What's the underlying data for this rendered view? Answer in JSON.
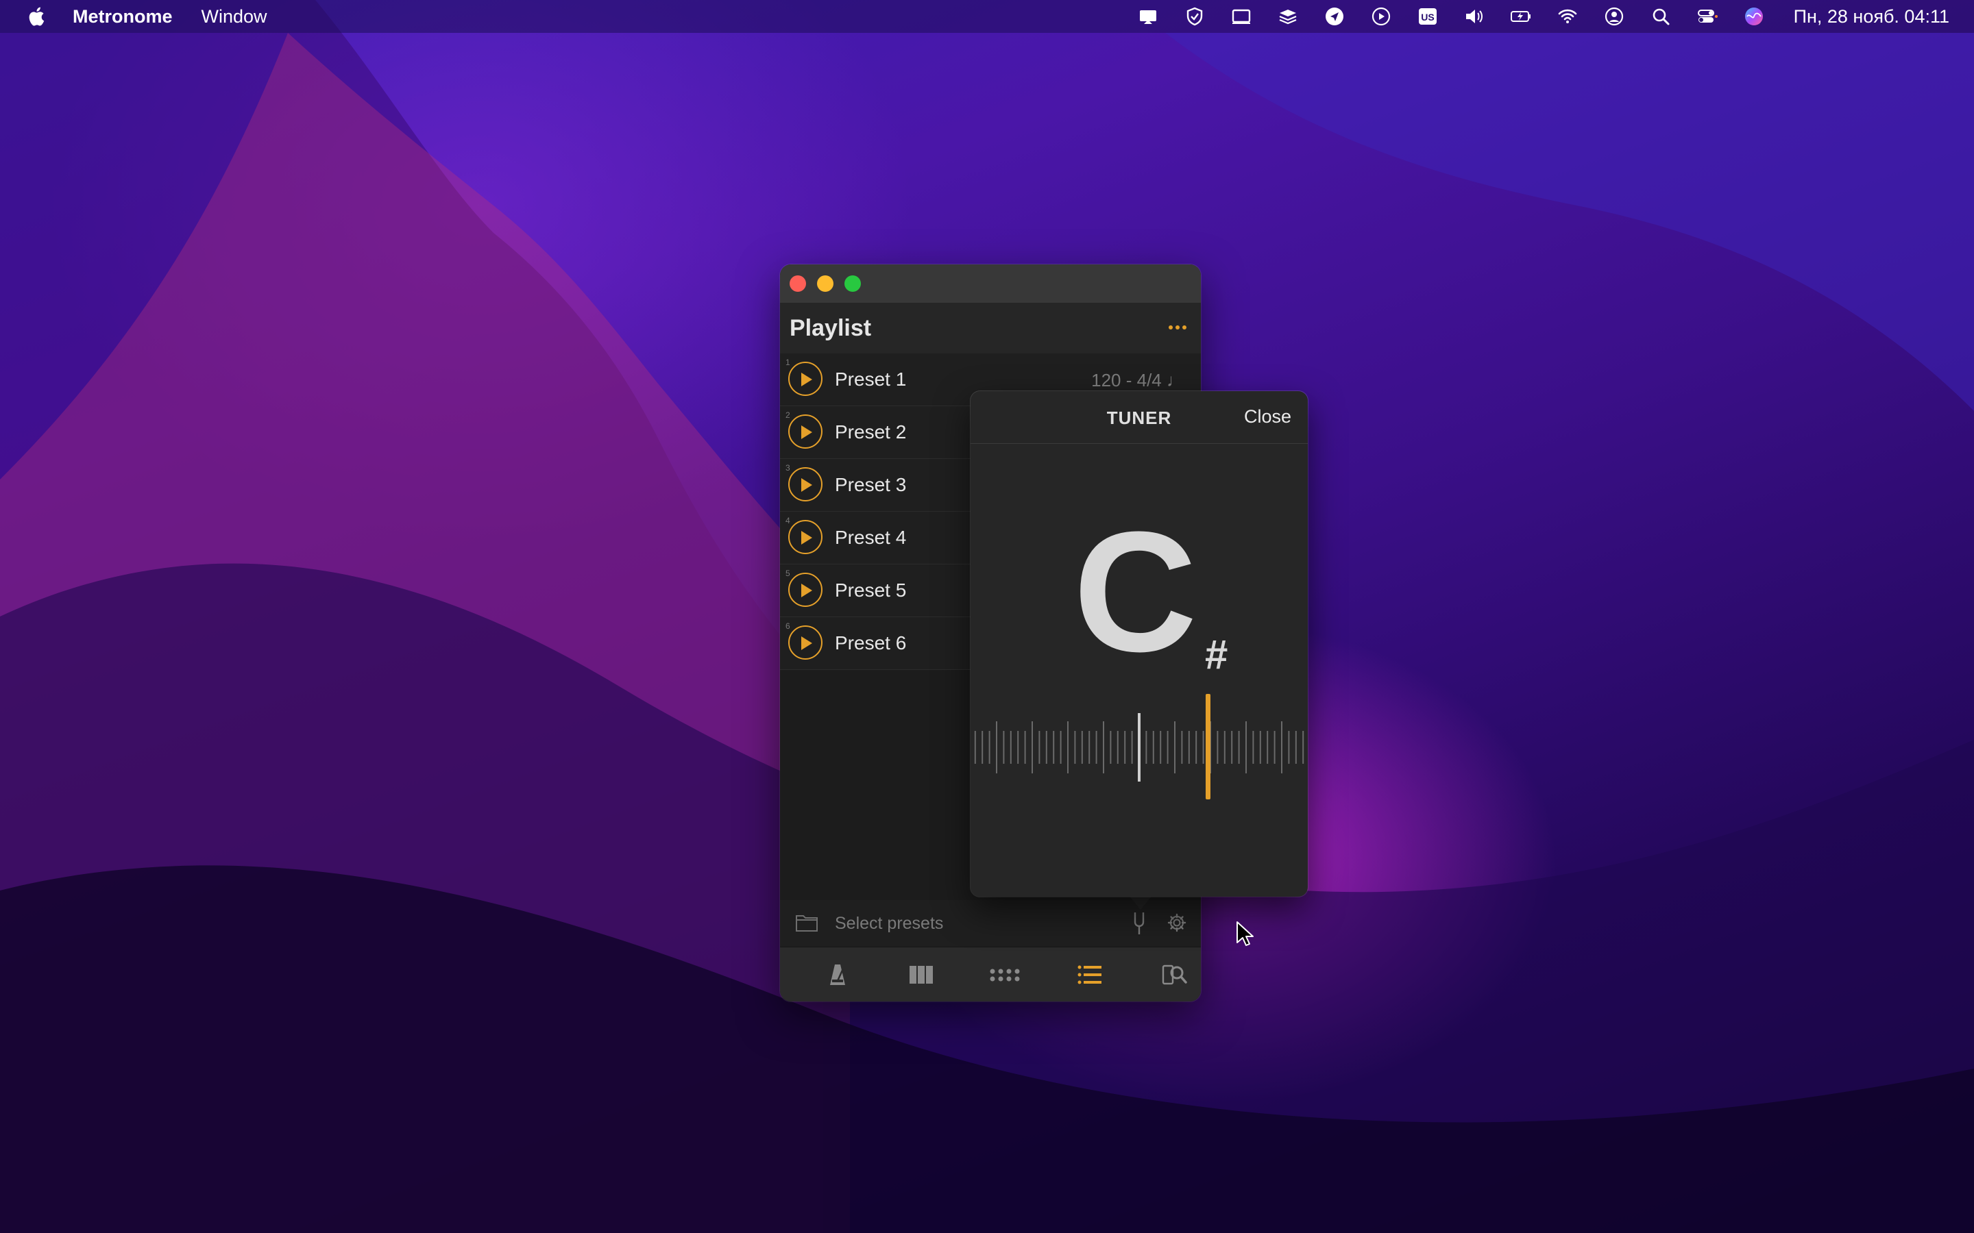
{
  "menubar": {
    "app_name": "Metronome",
    "menu_window": "Window",
    "clock": "Пн, 28 нояб. 04:11",
    "status_icons": [
      "screen-share-icon",
      "shield-icon",
      "display-icon",
      "stack-icon",
      "location-arrow-icon",
      "play-circle-icon",
      "input-source-us-icon",
      "volume-icon",
      "battery-charging-icon",
      "wifi-icon",
      "user-circle-icon",
      "spotlight-search-icon",
      "control-center-icon",
      "siri-icon"
    ],
    "input_source_label": "US"
  },
  "window": {
    "header_title": "Playlist",
    "presets": [
      {
        "index": "1",
        "label": "Preset 1",
        "meta": "120 - 4/4 ♩"
      },
      {
        "index": "2",
        "label": "Preset 2",
        "meta": ""
      },
      {
        "index": "3",
        "label": "Preset 3",
        "meta": ""
      },
      {
        "index": "4",
        "label": "Preset 4",
        "meta": ""
      },
      {
        "index": "5",
        "label": "Preset 5",
        "meta": ""
      },
      {
        "index": "6",
        "label": "Preset 6",
        "meta": ""
      }
    ],
    "select_presets_label": "Select presets",
    "tabs": [
      "metronome-tab-icon",
      "columns-tab-icon",
      "dots-tab-icon",
      "list-tab-icon",
      "search-tab-icon"
    ],
    "active_tab": "list-tab-icon"
  },
  "tuner": {
    "title": "TUNER",
    "close_label": "Close",
    "note": "C",
    "accidental": "#"
  },
  "colors": {
    "accent": "#e5a02a",
    "window_bg": "#1c1c1c",
    "popover_bg": "#262626"
  }
}
